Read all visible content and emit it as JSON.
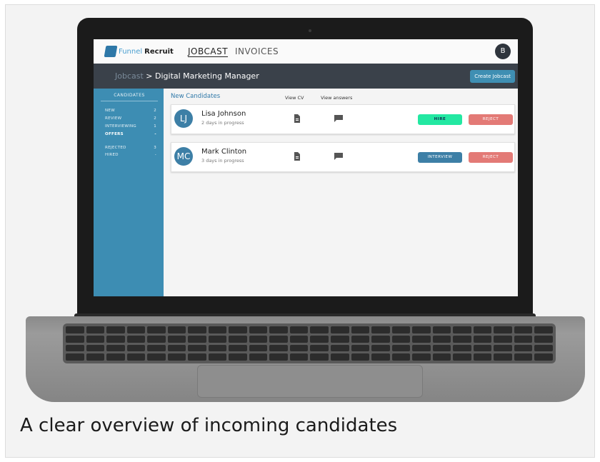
{
  "app": {
    "logo": {
      "part1": "Funnel",
      "part2": "Recruit"
    },
    "nav": [
      "JOBCAST",
      "INVOICES"
    ],
    "user_initial": "B"
  },
  "header": {
    "breadcrumb_root": "Jobcast",
    "breadcrumb_sep": ">",
    "page_title": "Digital Marketing Manager",
    "create_button": "Create Jobcast"
  },
  "sidebar": {
    "title": "CANDIDATES",
    "items": [
      {
        "label": "NEW",
        "count": "2"
      },
      {
        "label": "REVIEW",
        "count": "2"
      },
      {
        "label": "INTERVIEWING",
        "count": "1"
      },
      {
        "label": "OFFERS",
        "count": "-"
      },
      {
        "label": "REJECTED",
        "count": "3"
      },
      {
        "label": "HIRED",
        "count": "-"
      }
    ]
  },
  "main": {
    "section_title": "New Candidates",
    "col_cv": "View CV",
    "col_answers": "View answers",
    "candidates": [
      {
        "initials": "LJ",
        "name": "Lisa Johnson",
        "status": "2 days in progress",
        "primary_action": "HIRE",
        "secondary_action": "REJECT"
      },
      {
        "initials": "MC",
        "name": "Mark Clinton",
        "status": "3 days in progress",
        "primary_action": "INTERVIEW",
        "secondary_action": "REJECT"
      }
    ]
  },
  "caption": "A clear overview of incoming candidates",
  "colors": {
    "accent": "#3d8db3",
    "hire": "#23e8a2",
    "reject": "#e37a76",
    "header": "#3a414a"
  }
}
